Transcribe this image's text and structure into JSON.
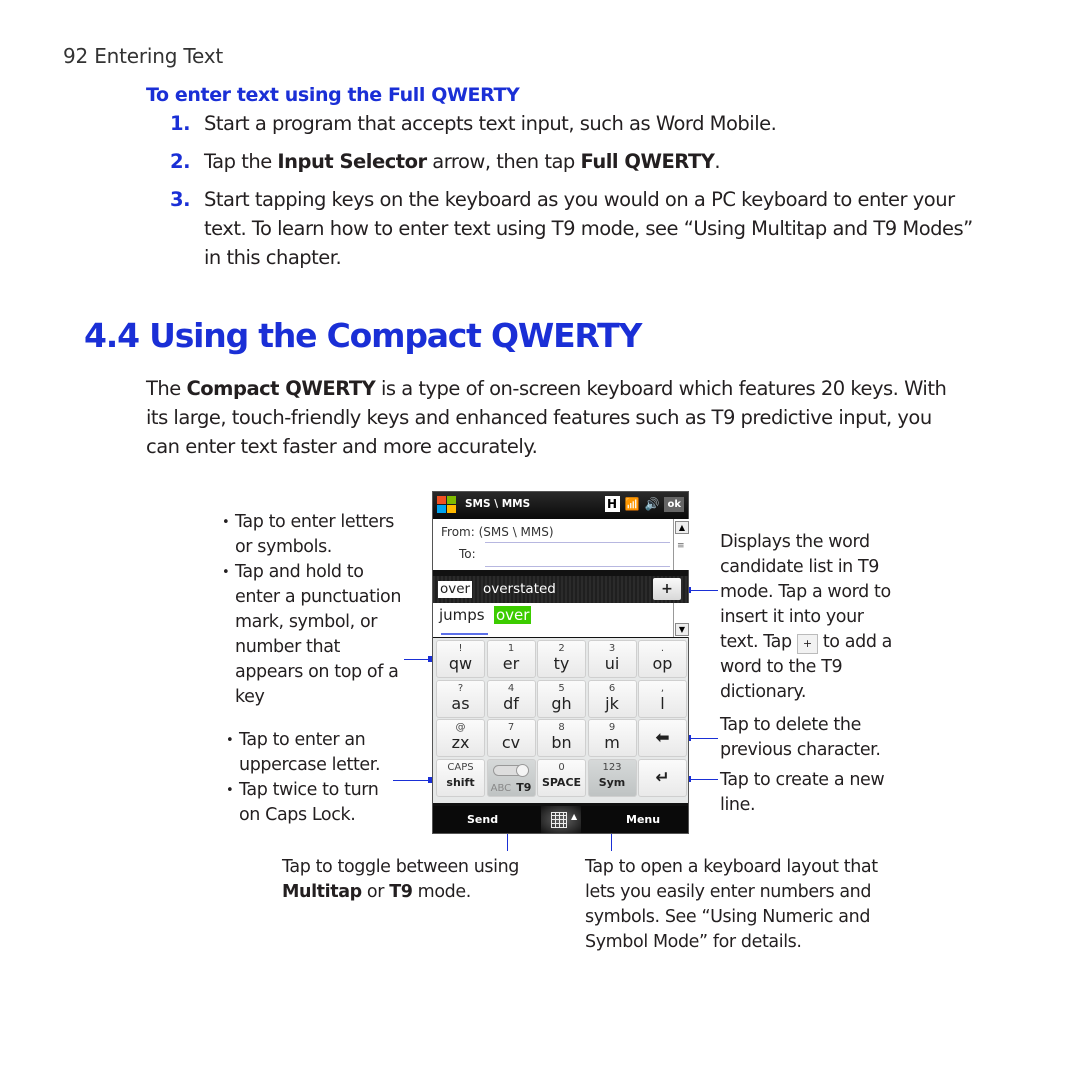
{
  "page": {
    "running_head": "92  Entering Text"
  },
  "procedure": {
    "title": "To enter text using the Full QWERTY",
    "steps": [
      {
        "num": "1.",
        "html_parts": [
          "Start a program that accepts text input, such as Word Mobile."
        ]
      },
      {
        "num": "2.",
        "pre": "Tap the ",
        "b1": "Input Selector",
        "mid": " arrow, then tap ",
        "b2": "Full QWERTY",
        "post": "."
      },
      {
        "num": "3.",
        "text": "Start tapping keys on the keyboard as you would on a PC keyboard to enter your text. To learn how to enter text using T9 mode, see “Using Multitap and T9 Modes” in this chapter."
      }
    ]
  },
  "section": {
    "title": "4.4 Using the Compact QWERTY",
    "intro_pre": "The ",
    "intro_bold": "Compact QWERTY",
    "intro_post": " is a type of on-screen keyboard which features 20 keys. With its large, touch-friendly keys and enhanced features such as T9 predictive input, you can enter text faster and more accurately."
  },
  "phone": {
    "titlebar": {
      "title": "SMS \\ MMS",
      "ok": "ok",
      "h_icon": "H"
    },
    "form": {
      "from_label": "From:",
      "from_value": "(SMS \\ MMS)",
      "to_label": "To:"
    },
    "candidates": {
      "selected": "over",
      "other": "overstated",
      "add": "+"
    },
    "typing": {
      "word1": "jumps",
      "word2": "over"
    },
    "keys": [
      [
        {
          "top": "!",
          "main": "qw"
        },
        {
          "top": "1",
          "main": "er"
        },
        {
          "top": "2",
          "main": "ty"
        },
        {
          "top": "3",
          "main": "ui"
        },
        {
          "top": ".",
          "main": "op"
        }
      ],
      [
        {
          "top": "?",
          "main": "as"
        },
        {
          "top": "4",
          "main": "df"
        },
        {
          "top": "5",
          "main": "gh"
        },
        {
          "top": "6",
          "main": "jk"
        },
        {
          "top": ",",
          "main": "l"
        }
      ],
      [
        {
          "top": "@",
          "main": "zx"
        },
        {
          "top": "7",
          "main": "cv"
        },
        {
          "top": "8",
          "main": "bn"
        },
        {
          "top": "9",
          "main": "m"
        },
        {
          "icon": "backspace"
        }
      ],
      [
        {
          "top": "CAPS",
          "main": "shift"
        },
        {
          "toggle_left": "ABC",
          "toggle_right": "T9"
        },
        {
          "top": "0",
          "main": "SPACE"
        },
        {
          "top": "123",
          "main": "Sym"
        },
        {
          "icon": "enter"
        }
      ]
    ],
    "softkeys": {
      "left": "Send",
      "right": "Menu"
    }
  },
  "callouts": {
    "left_top": [
      "Tap to enter letters or symbols.",
      "Tap and hold to enter a punctuation mark, symbol, or number that appears on top of a key"
    ],
    "left_bottom": [
      "Tap to enter an uppercase letter.",
      "Tap twice to turn on Caps Lock."
    ],
    "right_candidates_pre": "Displays the word candidate list in T9 mode. Tap a word to insert it into your text. Tap ",
    "right_candidates_post": " to add a word to the T9 dictionary.",
    "right_candidates_plus": "+",
    "right_delete": "Tap to delete the previous character.",
    "right_enter": "Tap to create a new line.",
    "bottom_toggle_pre": "Tap to toggle between using ",
    "bottom_toggle_b1": "Multitap",
    "bottom_toggle_mid": " or ",
    "bottom_toggle_b2": "T9",
    "bottom_toggle_post": " mode.",
    "bottom_sym": "Tap to open a keyboard layout that lets you easily enter numbers and symbols. See “Using Numeric and Symbol Mode” for details."
  },
  "colors": {
    "accent": "#1a2fd6",
    "highlight_green": "#3ccc00"
  }
}
